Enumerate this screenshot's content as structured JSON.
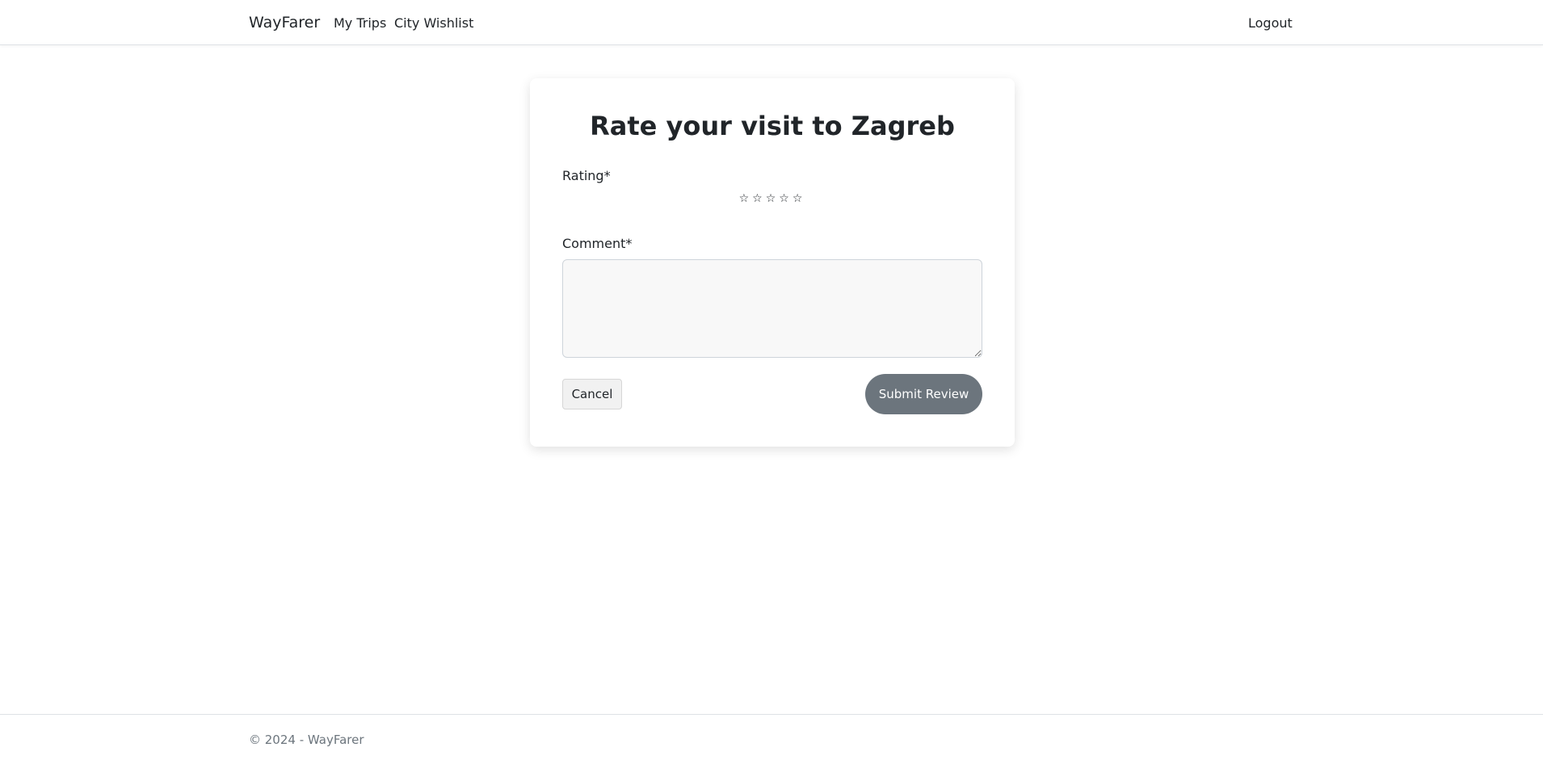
{
  "nav": {
    "brand": "WayFarer",
    "links": [
      {
        "label": "My Trips"
      },
      {
        "label": "City Wishlist"
      }
    ],
    "logout": "Logout"
  },
  "review_form": {
    "title": "Rate your visit to Zagreb",
    "rating_label": "Rating*",
    "rating_value": 0,
    "rating_max": 5,
    "star_glyph": "☆",
    "comment_label": "Comment*",
    "comment_value": "",
    "cancel_label": "Cancel",
    "submit_label": "Submit Review"
  },
  "footer": {
    "text": "© 2024 - WayFarer"
  },
  "colors": {
    "submit_button": "#6c757d",
    "footer_text": "#6c757d"
  }
}
